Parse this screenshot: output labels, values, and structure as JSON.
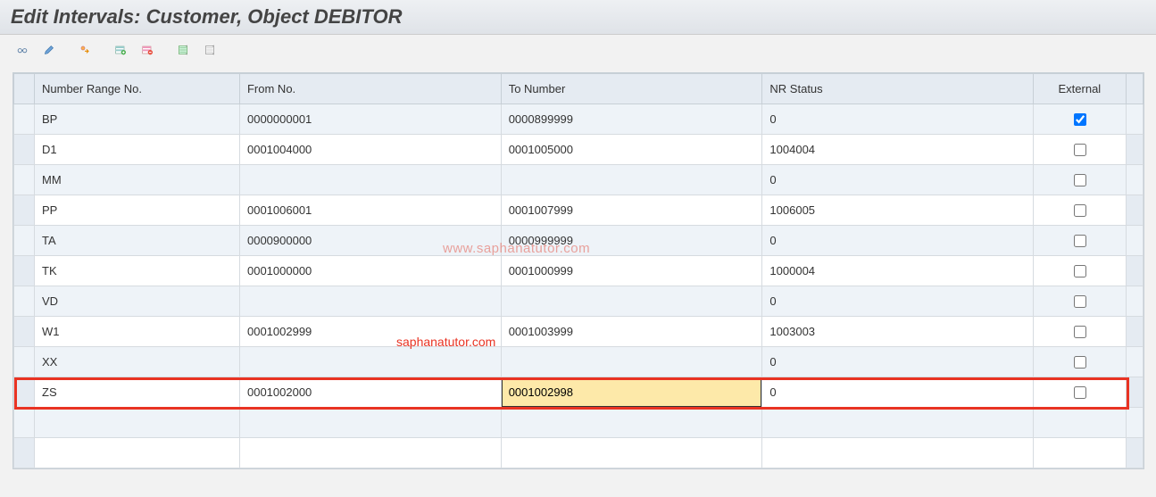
{
  "title": "Edit Intervals: Customer, Object DEBITOR",
  "toolbar": {
    "icons": [
      {
        "name": "glasses-icon"
      },
      {
        "name": "pencil-icon"
      },
      {
        "name": "change-status-icon"
      },
      {
        "name": "insert-row-icon"
      },
      {
        "name": "delete-row-icon"
      },
      {
        "name": "select-all-icon"
      },
      {
        "name": "deselect-all-icon"
      }
    ]
  },
  "columns": {
    "nr": "Number Range No.",
    "from": "From No.",
    "to": "To Number",
    "status": "NR Status",
    "ext": "External"
  },
  "rows": [
    {
      "nr": "BP",
      "from": "0000000001",
      "to": "0000899999",
      "status": "0",
      "ext": true
    },
    {
      "nr": "D1",
      "from": "0001004000",
      "to": "0001005000",
      "status": "1004004",
      "ext": false
    },
    {
      "nr": "MM",
      "from": "",
      "to": "",
      "status": "0",
      "ext": false
    },
    {
      "nr": "PP",
      "from": "0001006001",
      "to": "0001007999",
      "status": "1006005",
      "ext": false
    },
    {
      "nr": "TA",
      "from": "0000900000",
      "to": "0000999999",
      "status": "0",
      "ext": false
    },
    {
      "nr": "TK",
      "from": "0001000000",
      "to": "0001000999",
      "status": "1000004",
      "ext": false
    },
    {
      "nr": "VD",
      "from": "",
      "to": "",
      "status": "0",
      "ext": false
    },
    {
      "nr": "W1",
      "from": "0001002999",
      "to": "0001003999",
      "status": "1003003",
      "ext": false
    },
    {
      "nr": "XX",
      "from": "",
      "to": "",
      "status": "0",
      "ext": false
    },
    {
      "nr": "ZS",
      "from": "0001002000",
      "to": "0001002998",
      "status": "0",
      "ext": false,
      "highlight": true,
      "toActive": true
    }
  ],
  "watermarks": {
    "w1": "www.saphanatutor.com",
    "w2": "saphanatutor.com"
  }
}
